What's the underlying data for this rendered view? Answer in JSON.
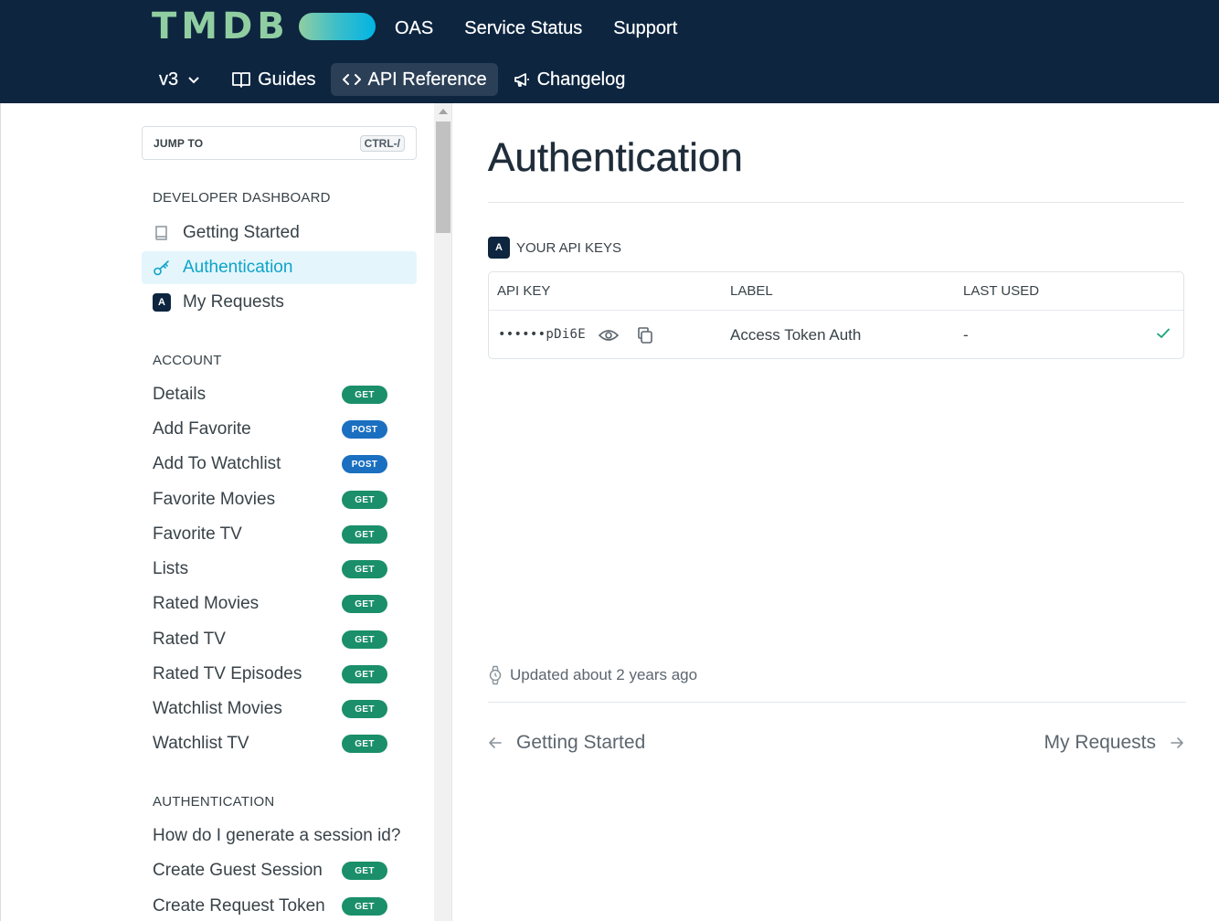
{
  "header": {
    "logo_text": "TMDB",
    "top_nav": [
      "OAS",
      "Service Status",
      "Support"
    ],
    "version": "v3",
    "sub_nav": {
      "guides": "Guides",
      "api_reference": "API Reference",
      "changelog": "Changelog"
    }
  },
  "sidebar": {
    "jump_to": "JUMP TO",
    "jump_shortcut": "CTRL-/",
    "sections": [
      {
        "title": "DEVELOPER DASHBOARD",
        "items": [
          {
            "label": "Getting Started",
            "icon": "book-icon"
          },
          {
            "label": "Authentication",
            "icon": "key-icon",
            "active": true
          },
          {
            "label": "My Requests",
            "icon": "a-badge-icon",
            "icon_text": "A"
          }
        ]
      },
      {
        "title": "ACCOUNT",
        "items": [
          {
            "label": "Details",
            "method": "GET"
          },
          {
            "label": "Add Favorite",
            "method": "POST"
          },
          {
            "label": "Add To Watchlist",
            "method": "POST"
          },
          {
            "label": "Favorite Movies",
            "method": "GET"
          },
          {
            "label": "Favorite TV",
            "method": "GET"
          },
          {
            "label": "Lists",
            "method": "GET"
          },
          {
            "label": "Rated Movies",
            "method": "GET"
          },
          {
            "label": "Rated TV",
            "method": "GET"
          },
          {
            "label": "Rated TV Episodes",
            "method": "GET"
          },
          {
            "label": "Watchlist Movies",
            "method": "GET"
          },
          {
            "label": "Watchlist TV",
            "method": "GET"
          }
        ]
      },
      {
        "title": "AUTHENTICATION",
        "items": [
          {
            "label": "How do I generate a session id?",
            "method": ""
          },
          {
            "label": "Create Guest Session",
            "method": "GET"
          },
          {
            "label": "Create Request Token",
            "method": "GET"
          }
        ]
      }
    ]
  },
  "main": {
    "title": "Authentication",
    "api_keys": {
      "title": "YOUR API KEYS",
      "icon_text": "A",
      "columns": [
        "API KEY",
        "LABEL",
        "LAST USED"
      ],
      "rows": [
        {
          "key": "••••••pDi6E",
          "label": "Access Token Auth",
          "last_used": "-"
        }
      ]
    },
    "updated": "Updated about 2 years ago",
    "pager": {
      "prev": "Getting Started",
      "next": "My Requests"
    }
  },
  "colors": {
    "header_bg": "#0d253f",
    "accent": "#0fa3c8",
    "get_badge": "#1a8f6a",
    "post_badge": "#1a6fc0",
    "logo_green": "#90cea1",
    "logo_blue": "#01b4e4"
  }
}
